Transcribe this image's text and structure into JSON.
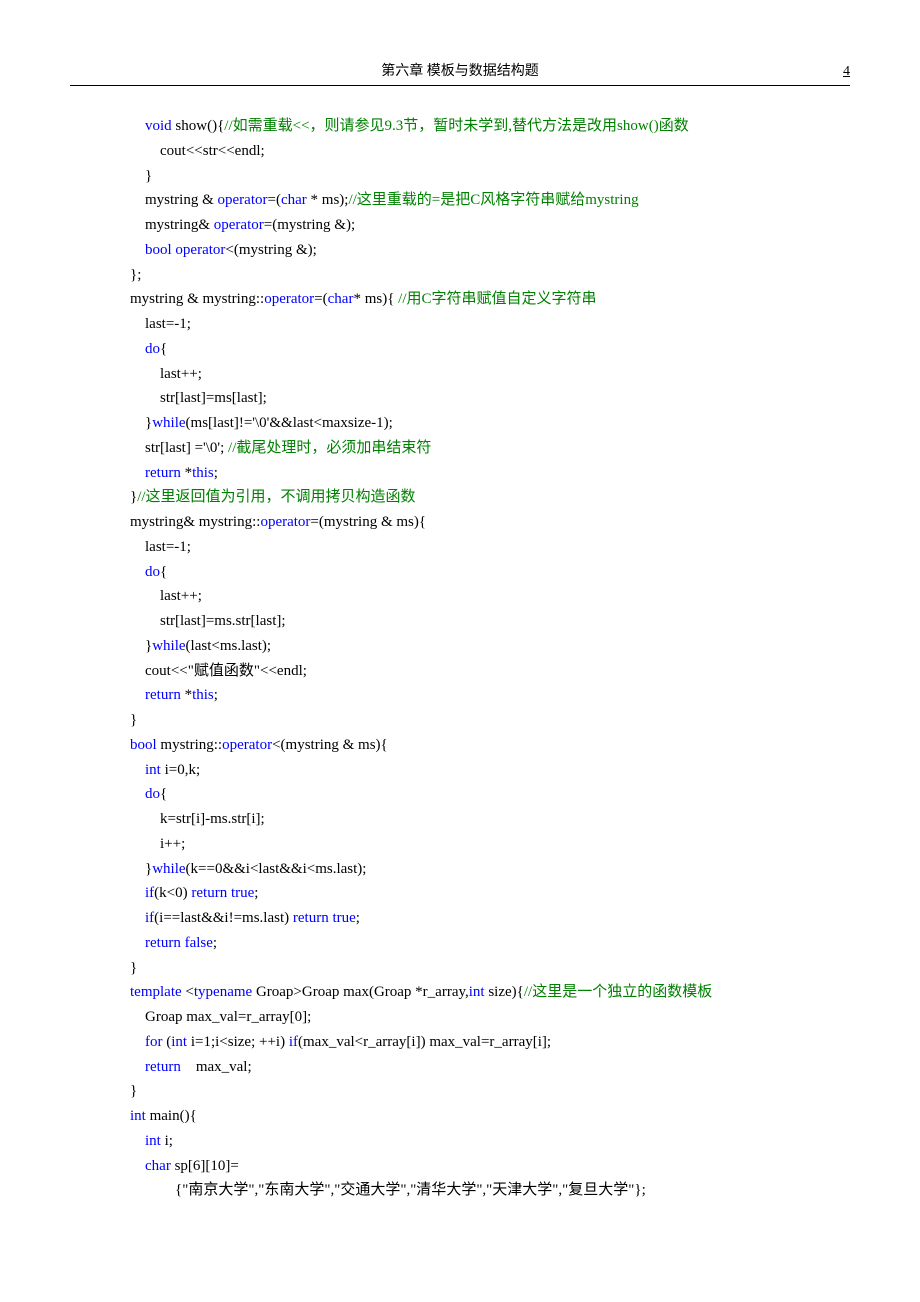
{
  "header": {
    "title": "第六章   模板与数据结构题",
    "page": "4"
  },
  "code": {
    "lines": [
      {
        "indent": 2,
        "segs": [
          {
            "t": "void",
            "c": "kw"
          },
          {
            "t": " show(){"
          },
          {
            "t": "//如需重载<<，则请参见9.3节，暂时未学到,替代方法是改用show()函数",
            "c": "cm"
          }
        ]
      },
      {
        "indent": 4,
        "segs": [
          {
            "t": "cout<<str<<endl;"
          }
        ]
      },
      {
        "indent": 2,
        "segs": [
          {
            "t": "}"
          }
        ]
      },
      {
        "indent": 2,
        "segs": [
          {
            "t": "mystring & "
          },
          {
            "t": "operator",
            "c": "kw"
          },
          {
            "t": "=("
          },
          {
            "t": "char",
            "c": "kw"
          },
          {
            "t": " * ms);"
          },
          {
            "t": "//这里重载的=是把C风格字符串赋给mystring",
            "c": "cm"
          }
        ]
      },
      {
        "indent": 2,
        "segs": [
          {
            "t": "mystring& "
          },
          {
            "t": "operator",
            "c": "kw"
          },
          {
            "t": "=(mystring &);"
          }
        ]
      },
      {
        "indent": 2,
        "segs": [
          {
            "t": "bool",
            "c": "kw"
          },
          {
            "t": " "
          },
          {
            "t": "operator",
            "c": "kw"
          },
          {
            "t": "<(mystring &);"
          }
        ]
      },
      {
        "indent": 0,
        "segs": [
          {
            "t": "};"
          }
        ]
      },
      {
        "indent": 0,
        "segs": [
          {
            "t": "mystring & mystring::"
          },
          {
            "t": "operator",
            "c": "kw"
          },
          {
            "t": "=("
          },
          {
            "t": "char",
            "c": "kw"
          },
          {
            "t": "* ms){ "
          },
          {
            "t": "//用C字符串赋值自定义字符串",
            "c": "cm"
          }
        ]
      },
      {
        "indent": 2,
        "segs": [
          {
            "t": "last=-1;"
          }
        ]
      },
      {
        "indent": 2,
        "segs": [
          {
            "t": "do",
            "c": "kw"
          },
          {
            "t": "{"
          }
        ]
      },
      {
        "indent": 4,
        "segs": [
          {
            "t": "last++;"
          }
        ]
      },
      {
        "indent": 4,
        "segs": [
          {
            "t": "str[last]=ms[last];"
          }
        ]
      },
      {
        "indent": 2,
        "segs": [
          {
            "t": "}"
          },
          {
            "t": "while",
            "c": "kw"
          },
          {
            "t": "(ms[last]!='\\0'&&last<maxsize-1);"
          }
        ]
      },
      {
        "indent": 2,
        "segs": [
          {
            "t": "str[last] ='\\0'; "
          },
          {
            "t": "//截尾处理时，必须加串结束符",
            "c": "cm"
          }
        ]
      },
      {
        "indent": 2,
        "segs": [
          {
            "t": "return",
            "c": "kw"
          },
          {
            "t": " *"
          },
          {
            "t": "this",
            "c": "kw"
          },
          {
            "t": ";"
          }
        ]
      },
      {
        "indent": 0,
        "segs": [
          {
            "t": "}"
          },
          {
            "t": "//这里返回值为引用，不调用拷贝构造函数",
            "c": "cm"
          }
        ]
      },
      {
        "indent": 0,
        "segs": [
          {
            "t": "mystring& mystring::"
          },
          {
            "t": "operator",
            "c": "kw"
          },
          {
            "t": "=(mystring & ms){"
          }
        ]
      },
      {
        "indent": 2,
        "segs": [
          {
            "t": "last=-1;"
          }
        ]
      },
      {
        "indent": 2,
        "segs": [
          {
            "t": "do",
            "c": "kw"
          },
          {
            "t": "{"
          }
        ]
      },
      {
        "indent": 4,
        "segs": [
          {
            "t": "last++;"
          }
        ]
      },
      {
        "indent": 4,
        "segs": [
          {
            "t": "str[last]=ms.str[last];"
          }
        ]
      },
      {
        "indent": 2,
        "segs": [
          {
            "t": "}"
          },
          {
            "t": "while",
            "c": "kw"
          },
          {
            "t": "(last<ms.last);"
          }
        ]
      },
      {
        "indent": 2,
        "segs": [
          {
            "t": "cout<<\"赋值函数\"<<endl;"
          }
        ]
      },
      {
        "indent": 2,
        "segs": [
          {
            "t": "return",
            "c": "kw"
          },
          {
            "t": " *"
          },
          {
            "t": "this",
            "c": "kw"
          },
          {
            "t": ";"
          }
        ]
      },
      {
        "indent": 0,
        "segs": [
          {
            "t": "}"
          }
        ]
      },
      {
        "indent": 0,
        "segs": [
          {
            "t": "bool",
            "c": "kw"
          },
          {
            "t": " mystring::"
          },
          {
            "t": "operator",
            "c": "kw"
          },
          {
            "t": "<(mystring & ms){"
          }
        ]
      },
      {
        "indent": 2,
        "segs": [
          {
            "t": "int",
            "c": "kw"
          },
          {
            "t": " i=0,k;"
          }
        ]
      },
      {
        "indent": 2,
        "segs": [
          {
            "t": "do",
            "c": "kw"
          },
          {
            "t": "{"
          }
        ]
      },
      {
        "indent": 4,
        "segs": [
          {
            "t": "k=str[i]-ms.str[i];"
          }
        ]
      },
      {
        "indent": 4,
        "segs": [
          {
            "t": "i++;"
          }
        ]
      },
      {
        "indent": 2,
        "segs": [
          {
            "t": "}"
          },
          {
            "t": "while",
            "c": "kw"
          },
          {
            "t": "(k==0&&i<last&&i<ms.last);"
          }
        ]
      },
      {
        "indent": 2,
        "segs": [
          {
            "t": "if",
            "c": "kw"
          },
          {
            "t": "(k<0) "
          },
          {
            "t": "return",
            "c": "kw"
          },
          {
            "t": " "
          },
          {
            "t": "true",
            "c": "kw"
          },
          {
            "t": ";"
          }
        ]
      },
      {
        "indent": 2,
        "segs": [
          {
            "t": "if",
            "c": "kw"
          },
          {
            "t": "(i==last&&i!=ms.last) "
          },
          {
            "t": "return",
            "c": "kw"
          },
          {
            "t": " "
          },
          {
            "t": "true",
            "c": "kw"
          },
          {
            "t": ";"
          }
        ]
      },
      {
        "indent": 2,
        "segs": [
          {
            "t": "return",
            "c": "kw"
          },
          {
            "t": " "
          },
          {
            "t": "false",
            "c": "kw"
          },
          {
            "t": ";"
          }
        ]
      },
      {
        "indent": 0,
        "segs": [
          {
            "t": "}"
          }
        ]
      },
      {
        "indent": 0,
        "segs": [
          {
            "t": "template",
            "c": "kw"
          },
          {
            "t": " <"
          },
          {
            "t": "typename",
            "c": "kw"
          },
          {
            "t": " Groap>Groap max(Groap *r_array,"
          },
          {
            "t": "int",
            "c": "kw"
          },
          {
            "t": " size){"
          },
          {
            "t": "//这里是一个独立的函数模板",
            "c": "cm"
          }
        ]
      },
      {
        "indent": 2,
        "segs": [
          {
            "t": "Groap max_val=r_array[0];"
          }
        ]
      },
      {
        "indent": 2,
        "segs": [
          {
            "t": "for",
            "c": "kw"
          },
          {
            "t": " ("
          },
          {
            "t": "int",
            "c": "kw"
          },
          {
            "t": " i=1;i<size; ++i) "
          },
          {
            "t": "if",
            "c": "kw"
          },
          {
            "t": "(max_val<r_array[i]) max_val=r_array[i];"
          }
        ]
      },
      {
        "indent": 2,
        "segs": [
          {
            "t": "return",
            "c": "kw"
          },
          {
            "t": "    max_val;"
          }
        ]
      },
      {
        "indent": 0,
        "segs": [
          {
            "t": "}"
          }
        ]
      },
      {
        "indent": 0,
        "segs": [
          {
            "t": "int",
            "c": "kw"
          },
          {
            "t": " main(){"
          }
        ]
      },
      {
        "indent": 2,
        "segs": [
          {
            "t": "int",
            "c": "kw"
          },
          {
            "t": " i;"
          }
        ]
      },
      {
        "indent": 2,
        "segs": [
          {
            "t": "char",
            "c": "kw"
          },
          {
            "t": " sp[6][10]="
          }
        ]
      },
      {
        "indent": 6,
        "segs": [
          {
            "t": "{\"南京大学\",\"东南大学\",\"交通大学\",\"清华大学\",\"天津大学\",\"复旦大学\"};"
          }
        ]
      }
    ]
  }
}
